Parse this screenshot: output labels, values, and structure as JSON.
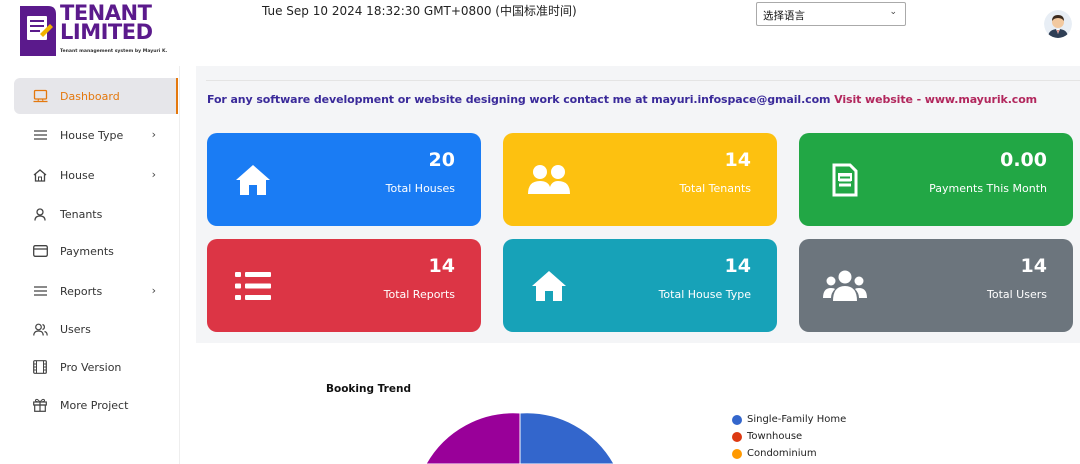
{
  "header": {
    "logo_title_1": "TENANT",
    "logo_title_2": "LIMITED",
    "logo_subtitle": "Tenant management system by Mayuri K.",
    "datetime": "Tue Sep 10 2024 18:32:30 GMT+0800 (中国标准时间)",
    "language_select": "选择语言"
  },
  "sidebar": {
    "items": [
      {
        "label": "Dashboard",
        "icon": "laptop-icon",
        "has_arrow": false,
        "active": true
      },
      {
        "label": "House Type",
        "icon": "list-icon",
        "has_arrow": true
      },
      {
        "label": "House",
        "icon": "home-icon",
        "has_arrow": true
      },
      {
        "label": "Tenants",
        "icon": "user-icon",
        "has_arrow": false
      },
      {
        "label": "Payments",
        "icon": "credit-card-icon",
        "has_arrow": false
      },
      {
        "label": "Reports",
        "icon": "list-icon",
        "has_arrow": true
      },
      {
        "label": "Users",
        "icon": "users-icon",
        "has_arrow": false
      },
      {
        "label": "Pro Version",
        "icon": "film-icon",
        "has_arrow": false
      },
      {
        "label": "More Project",
        "icon": "gift-icon",
        "has_arrow": false
      }
    ]
  },
  "promo": {
    "text_part1": "For any software development or website designing work contact me at mayuri.infospace@gmail.com",
    "text_part2": "Visit website - www.mayurik.com"
  },
  "cards": [
    {
      "value": "20",
      "label": "Total Houses",
      "color": "#1a7cf4",
      "icon": "home-icon"
    },
    {
      "value": "14",
      "label": "Total Tenants",
      "color": "#fdc110",
      "icon": "users-icon"
    },
    {
      "value": "0.00",
      "label": "Payments This Month",
      "color": "#22a745",
      "icon": "receipt-icon"
    },
    {
      "value": "14",
      "label": "Total Reports",
      "color": "#dc3545",
      "icon": "list-icon"
    },
    {
      "value": "14",
      "label": "Total House Type",
      "color": "#17a2b8",
      "icon": "home-icon"
    },
    {
      "value": "14",
      "label": "Total Users",
      "color": "#6c757d",
      "icon": "users-icon"
    }
  ],
  "chart": {
    "title": "Booking Trend",
    "legend": [
      {
        "label": "Single-Family Home",
        "color": "#3366cc"
      },
      {
        "label": "Townhouse",
        "color": "#dc3912"
      },
      {
        "label": "Condominium",
        "color": "#ff9900"
      }
    ],
    "visible_slice_colors": [
      "#990099",
      "#3366cc"
    ]
  }
}
